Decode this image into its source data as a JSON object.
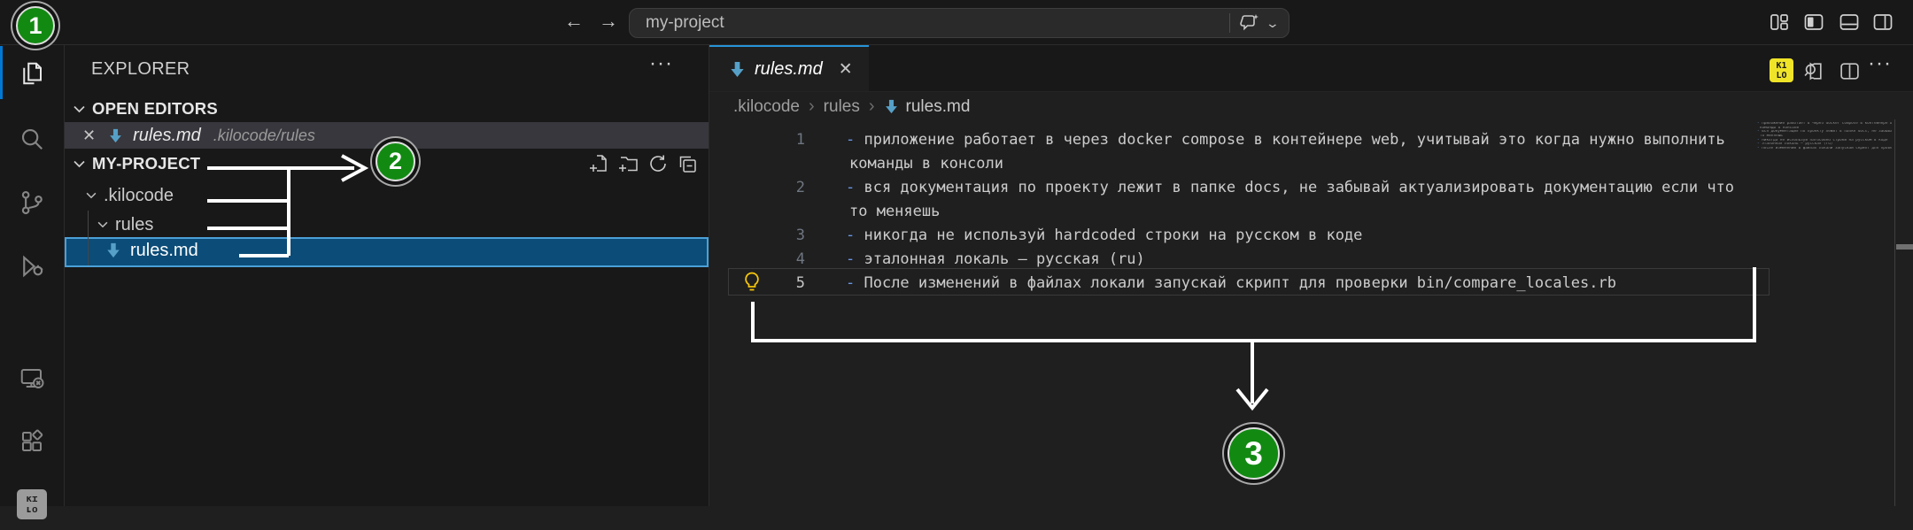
{
  "colors": {
    "annotation_green": "#128a12",
    "tab_accent_blue": "#2794d8",
    "selection_bg": "#0b4c78",
    "selection_border": "#4ba0d7",
    "md_icon_blue": "#56a0c8",
    "list_marker_blue": "#6796e6",
    "kilo_yellow": "#f0e428"
  },
  "annotations": {
    "badge1": "1",
    "badge2": "2",
    "badge3": "3"
  },
  "title_bar": {
    "back": "←",
    "forward": "→",
    "command_center_value": "my-project",
    "command_chevron": "⌄",
    "window_icons": [
      "customize-layout",
      "toggle-primary-sidebar",
      "toggle-panel",
      "toggle-secondary-sidebar"
    ]
  },
  "activity_bar": {
    "items": [
      "explorer",
      "search",
      "source-control",
      "run-and-debug",
      "remote-explorer",
      "extensions",
      "kilo-code"
    ]
  },
  "explorer": {
    "title": "EXPLORER",
    "more": "···",
    "open_editors_header": "OPEN EDITORS",
    "open_editor": {
      "close": "✕",
      "name": "rules.md",
      "description": ".kilocode/rules"
    },
    "project_header": "MY-PROJECT",
    "toolbar": [
      "new-file",
      "new-folder",
      "refresh",
      "collapse-all"
    ],
    "tree": [
      {
        "label": ".kilocode"
      },
      {
        "label": "rules"
      },
      {
        "label": "rules.md",
        "selected": true
      }
    ]
  },
  "editor": {
    "tab": {
      "name": "rules.md",
      "close": "✕"
    },
    "breadcrumbs": {
      "a": ".kilocode",
      "b": "rules",
      "c": "rules.md",
      "sep": "›"
    },
    "actions": {
      "kilo_line1": "K1",
      "kilo_line2": "LO",
      "more": "···"
    },
    "rows": [
      {
        "num": "1",
        "marker": "- ",
        "text": "приложение работает в через docker compose в контейнере web, учитывай это когда нужно выполнить"
      },
      {
        "text": "команды в консоли"
      },
      {
        "num": "2",
        "marker": "- ",
        "text": "вся документация по проекту лежит в папке docs, не забывай актуализировать документацию если что"
      },
      {
        "text": "то меняешь"
      },
      {
        "num": "3",
        "marker": "- ",
        "text": "никогда не используй hardcoded строки на русском в коде"
      },
      {
        "num": "4",
        "marker": "- ",
        "text": "эталонная локаль — русская (ru)"
      },
      {
        "num": "5",
        "marker": "- ",
        "text": "После изменений в файлах локали запускай скрипт для проверки bin/compare_locales.rb"
      }
    ]
  }
}
